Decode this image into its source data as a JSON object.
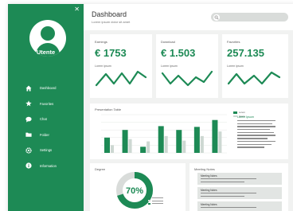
{
  "app": {
    "title": "Dashboard",
    "subtitle": "Lorem ipsum dolor sit amet"
  },
  "colors": {
    "brand": "#1d8a55",
    "light_bar": "#cdd8d2",
    "background": "#f1f2f1"
  },
  "user": {
    "name": "Utente"
  },
  "nav": {
    "items": [
      {
        "label": "Dashboard",
        "icon": "home-icon"
      },
      {
        "label": "Favorites",
        "icon": "star-icon"
      },
      {
        "label": "Chat",
        "icon": "chat-bubble-icon"
      },
      {
        "label": "Folder",
        "icon": "folder-icon"
      },
      {
        "label": "Settings",
        "icon": "gear-icon"
      },
      {
        "label": "Information",
        "icon": "info-icon"
      }
    ]
  },
  "search": {
    "icon": "search-icon"
  },
  "stats": [
    {
      "label": "Earnings",
      "value": "€ 1753",
      "caption": "Lorem ipsum"
    },
    {
      "label": "Download",
      "value": "€ 1.503",
      "caption": "Lorem ipsum"
    },
    {
      "label": "Favorites",
      "value": "257.135",
      "caption": "Lorem ipsum"
    }
  ],
  "chart_data": {
    "type": "bar",
    "title": "Presentation Table",
    "categories": [
      "1",
      "2",
      "3",
      "4",
      "5",
      "6",
      "7"
    ],
    "series": [
      {
        "name": "Lorem",
        "values": [
          20,
          30,
          8,
          35,
          30,
          34,
          43
        ]
      },
      {
        "name": "Ipsum",
        "values": [
          10,
          18,
          15,
          22,
          16,
          22,
          28
        ]
      }
    ],
    "ylim": [
      0,
      50
    ],
    "grid": true,
    "legend": "top-right"
  },
  "chart_side": {
    "title": "Lorem Ipsum"
  },
  "gauge": {
    "label": "Degree",
    "value_text": "70%",
    "percent": 70
  },
  "notes": {
    "title": "Meeting Notes",
    "items": [
      {
        "title": "Meeting Notes"
      },
      {
        "title": "Meeting Notes"
      },
      {
        "title": "Meeting Notes"
      }
    ]
  }
}
